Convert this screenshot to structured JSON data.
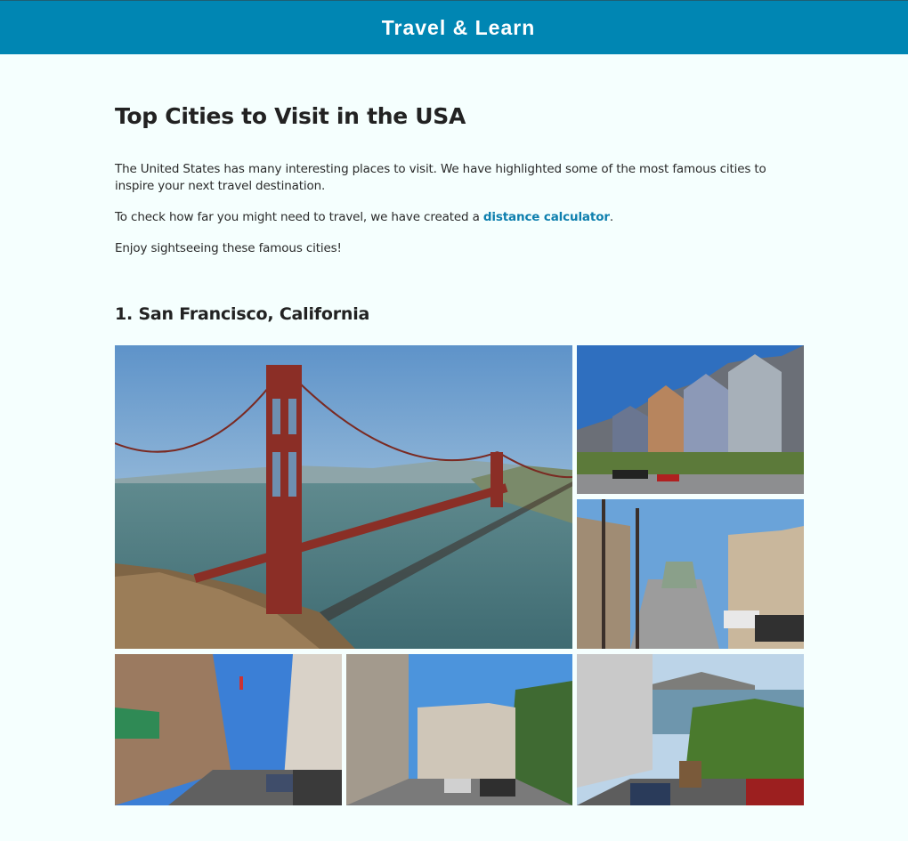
{
  "header": {
    "title": "Travel & Learn"
  },
  "page": {
    "title": "Top Cities to Visit in the USA",
    "intro": "The United States has many interesting places to visit. We have highlighted some of the most famous cities to inspire your next travel destination.",
    "calc_prefix": "To check how far you might need to travel, we have created a ",
    "calc_link": "distance calculator",
    "calc_suffix": ".",
    "closing": "Enjoy sightseeing these famous cities!"
  },
  "sections": [
    {
      "title": "1. San Francisco, California",
      "photos": [
        "golden-gate-bridge",
        "painted-ladies",
        "steep-street-hill",
        "chinatown-street",
        "hill-street-bay-view",
        "alcatraz-view-street"
      ]
    }
  ],
  "colors": {
    "header_bg": "#0086b3",
    "link": "#0d7fae",
    "page_bg": "#f5fffe"
  }
}
